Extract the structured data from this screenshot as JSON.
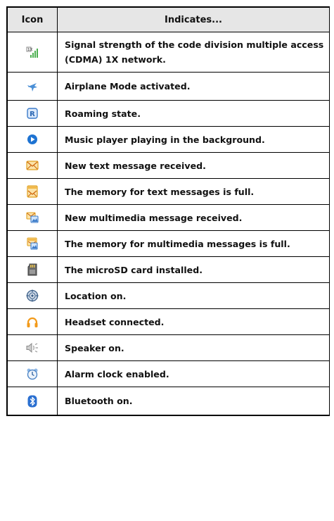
{
  "table": {
    "headers": {
      "icon": "Icon",
      "indicates": "Indicates..."
    },
    "rows": [
      {
        "icon": "cdma-signal-icon",
        "text": "Signal strength of the code division multiple access (CDMA) 1X network."
      },
      {
        "icon": "airplane-mode-icon",
        "text": "Airplane Mode activated."
      },
      {
        "icon": "roaming-icon",
        "text": "Roaming state."
      },
      {
        "icon": "music-playing-icon",
        "text": "Music player playing in the background."
      },
      {
        "icon": "new-text-message-icon",
        "text": "New text message received."
      },
      {
        "icon": "text-memory-full-icon",
        "text": "The memory for text messages is full."
      },
      {
        "icon": "new-mms-icon",
        "text": "New multimedia message received."
      },
      {
        "icon": "mms-memory-full-icon",
        "text": "The memory for multimedia messages is full."
      },
      {
        "icon": "microsd-card-icon",
        "text": "The microSD card installed."
      },
      {
        "icon": "location-on-icon",
        "text": "Location on."
      },
      {
        "icon": "headset-icon",
        "text": "Headset connected."
      },
      {
        "icon": "speaker-on-icon",
        "text": "Speaker on."
      },
      {
        "icon": "alarm-clock-icon",
        "text": "Alarm clock enabled."
      },
      {
        "icon": "bluetooth-icon",
        "text": "Bluetooth on."
      }
    ]
  }
}
